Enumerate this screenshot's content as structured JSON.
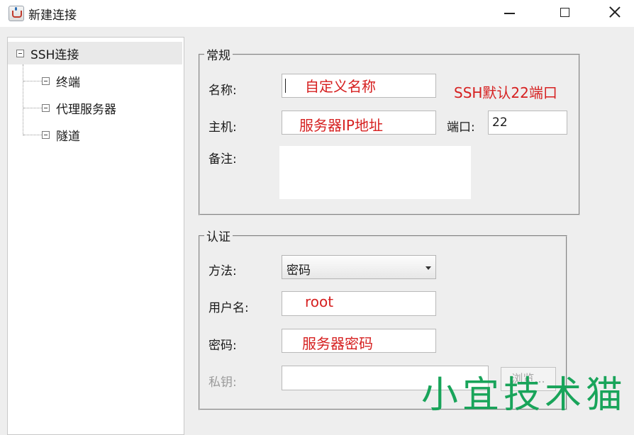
{
  "window": {
    "title": "新建连接"
  },
  "tree": {
    "root": "SSH连接",
    "children": [
      "终端",
      "代理服务器",
      "隧道"
    ]
  },
  "general": {
    "legend": "常规",
    "name_label": "名称:",
    "name_value": "自定义名称",
    "host_label": "主机:",
    "host_value": "服务器IP地址",
    "port_label": "端口:",
    "port_value": "22",
    "note_label": "备注:",
    "port_hint": "SSH默认22端口"
  },
  "auth": {
    "legend": "认证",
    "method_label": "方法:",
    "method_value": "密码",
    "user_label": "用户名:",
    "user_value": "root",
    "password_label": "密码:",
    "password_value": "服务器密码",
    "key_label": "私钥:",
    "browse_label": "浏览..."
  },
  "watermark": "小宜技术猫",
  "colors": {
    "annotation": "#d62020",
    "watermark": "#19a45a"
  }
}
